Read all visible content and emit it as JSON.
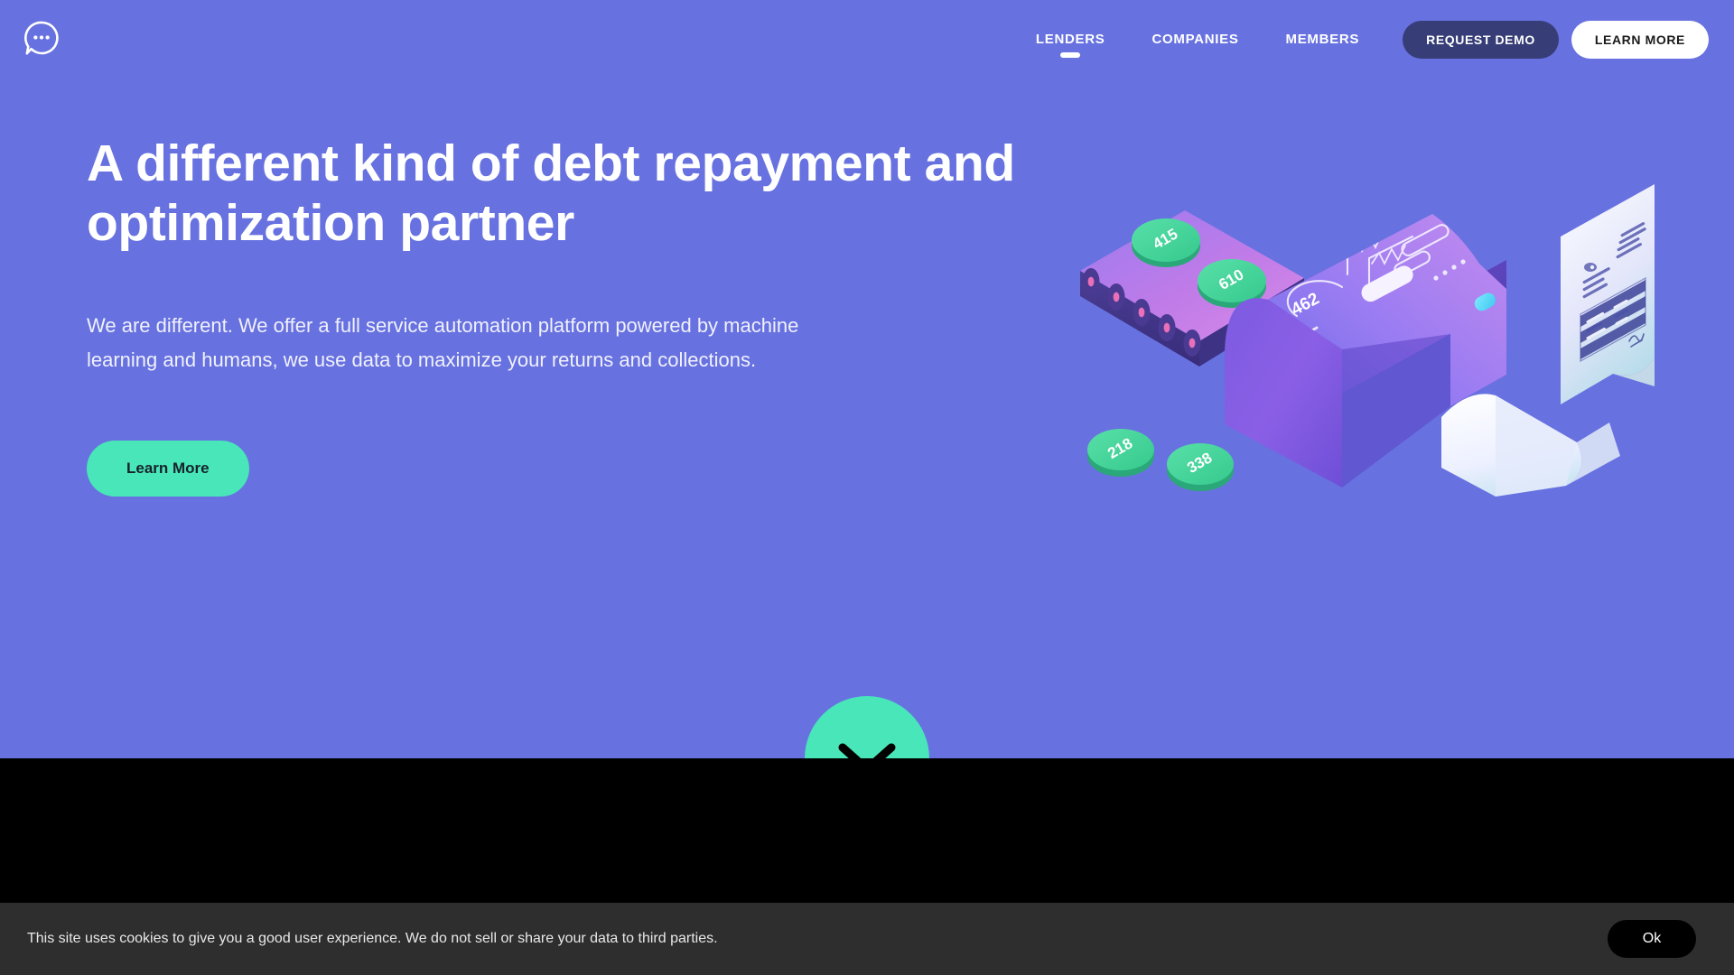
{
  "brand": {
    "logo_icon": "chat-bubble-dots-icon"
  },
  "colors": {
    "hero_bg": "#6771E0",
    "accent_mint": "#48E6B8",
    "nav_demo_btn": "#373E77",
    "dark_section": "#000000",
    "cookie_bar": "#2E2E2E"
  },
  "nav": {
    "links": [
      {
        "label": "LENDERS",
        "active": true
      },
      {
        "label": "COMPANIES",
        "active": false
      },
      {
        "label": "MEMBERS",
        "active": false
      }
    ],
    "request_demo_label": "REQUEST DEMO",
    "learn_more_label": "LEARN MORE"
  },
  "hero": {
    "headline": "A different kind of debt repayment and optimization partner",
    "subcopy": "We are different. We offer a full service automation platform powered by machine learning and humans, we use data to maximize your returns and collections.",
    "cta_label": "Learn More"
  },
  "illustration": {
    "name": "isometric-payment-machine",
    "gauge_value": "462",
    "coins": [
      {
        "value": "415"
      },
      {
        "value": "610"
      },
      {
        "value": "218"
      },
      {
        "value": "338"
      }
    ]
  },
  "scroll": {
    "icon": "chevron-down-icon"
  },
  "cookie": {
    "message": "This site uses cookies to give you a good user experience. We do not sell or share your data to third parties.",
    "ok_label": "Ok"
  }
}
